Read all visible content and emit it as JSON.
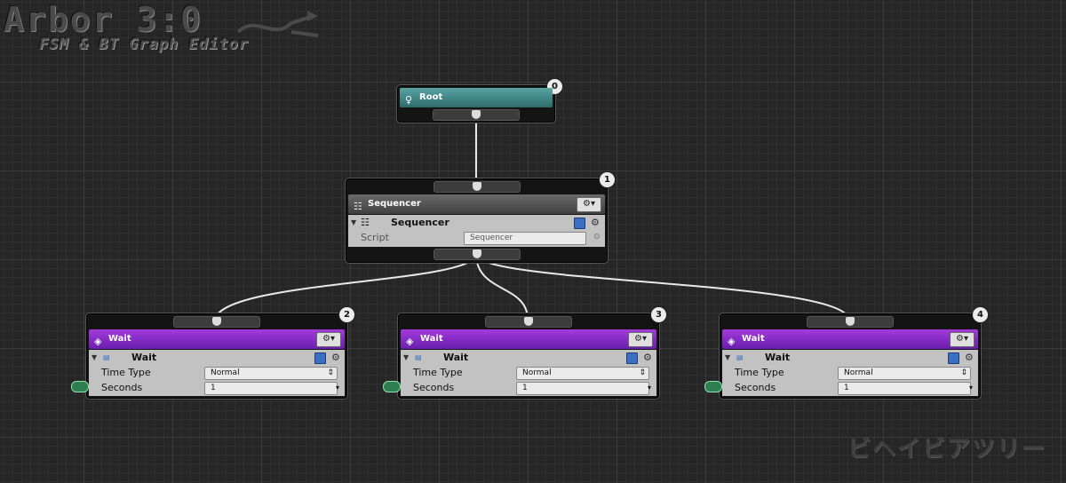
{
  "logo": {
    "title": "Arbor 3:0",
    "subtitle": "FSM & BT Graph Editor"
  },
  "watermark": "ビヘイビアツリー",
  "colors": {
    "root": "#2d6b6b",
    "sequencer": "#3f3f3f",
    "wait": "#6a1eb0",
    "port": "#2e7d4f"
  },
  "nodes": {
    "root": {
      "index": "0",
      "title": "Root",
      "icon": "root-icon"
    },
    "sequencer": {
      "index": "1",
      "title": "Sequencer",
      "icon": "sequencer-icon",
      "component": "Sequencer",
      "script_label": "Script",
      "script_value": "Sequencer"
    },
    "waits": [
      {
        "index": "2",
        "title": "Wait",
        "component": "Wait",
        "time_type_label": "Time Type",
        "time_type_value": "Normal",
        "seconds_label": "Seconds",
        "seconds_value": "1"
      },
      {
        "index": "3",
        "title": "Wait",
        "component": "Wait",
        "time_type_label": "Time Type",
        "time_type_value": "Normal",
        "seconds_label": "Seconds",
        "seconds_value": "1"
      },
      {
        "index": "4",
        "title": "Wait",
        "component": "Wait",
        "time_type_label": "Time Type",
        "time_type_value": "Normal",
        "seconds_label": "Seconds",
        "seconds_value": "1"
      }
    ]
  },
  "icons": {
    "gear": "⚙▾",
    "small_gear": "⚙",
    "dropdown": "⇕",
    "step": "▾",
    "fold": "▼"
  }
}
